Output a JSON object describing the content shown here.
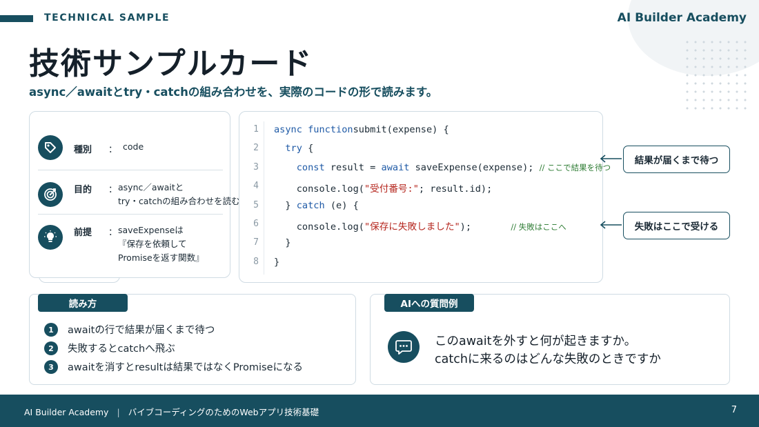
{
  "header": {
    "label": "TECHNICAL SAMPLE",
    "brand": "AI Builder Academy",
    "title": "技術サンプルカード",
    "subtitle": "async／awaitとtry・catchの組み合わせを、実際のコードの形で読みます。"
  },
  "info": {
    "rows": [
      {
        "label": "種別",
        "value_lines": [
          "code"
        ],
        "icon": "tag-icon"
      },
      {
        "label": "目的",
        "value_lines": [
          "async／awaitと",
          "try・catchの組み合わせを読む"
        ],
        "icon": "target-icon"
      },
      {
        "label": "前提",
        "value_lines": [
          "saveExpenseは",
          "『保存を依頼して",
          "Promiseを返す関数』"
        ],
        "icon": "lightbulb-icon"
      }
    ],
    "colon": "："
  },
  "code": {
    "lines": [
      {
        "n": "1",
        "parts": [
          [
            "kw",
            "async function"
          ],
          [
            "",
            "submit(expense) {"
          ]
        ]
      },
      {
        "n": "2",
        "parts": [
          [
            "",
            "  "
          ],
          [
            "kw",
            "try"
          ],
          [
            "",
            " {"
          ]
        ]
      },
      {
        "n": "3",
        "parts": [
          [
            "",
            "    "
          ],
          [
            "kw",
            "const"
          ],
          [
            "",
            " result = "
          ],
          [
            "kw",
            "await"
          ],
          [
            "",
            " saveExpense(expense); "
          ],
          [
            "cmt",
            "// ここで結果を待つ"
          ]
        ]
      },
      {
        "n": "4",
        "parts": [
          [
            "",
            "    console.log("
          ],
          [
            "str",
            "\"受付番号:\""
          ],
          [
            "",
            "; result.id);"
          ]
        ]
      },
      {
        "n": "5",
        "parts": [
          [
            "",
            "  } "
          ],
          [
            "kw",
            "catch"
          ],
          [
            "",
            " (e) {"
          ]
        ]
      },
      {
        "n": "6",
        "parts": [
          [
            "",
            "    console.log("
          ],
          [
            "str",
            "\"保存に失敗しました\""
          ],
          [
            "",
            ");       "
          ],
          [
            "cmt",
            "// 失敗はここへ"
          ]
        ]
      },
      {
        "n": "7",
        "parts": [
          [
            "",
            "  }"
          ]
        ]
      },
      {
        "n": "8",
        "parts": [
          [
            "",
            "}"
          ]
        ]
      }
    ]
  },
  "callouts": {
    "wait": "結果が届くまで待つ",
    "catch": "失敗はここで受ける"
  },
  "reading": {
    "title": "読み方",
    "steps": [
      {
        "n": "1",
        "text": "awaitの行で結果が届くまで待つ"
      },
      {
        "n": "2",
        "text": "失敗するとcatchへ飛ぶ"
      },
      {
        "n": "3",
        "text": "awaitを消すとresultは結果ではなくPromiseになる"
      }
    ]
  },
  "questions": {
    "title": "AIへの質問例",
    "lines": [
      "このawaitを外すと何が起きますか。",
      "catchに来るのはどんな失敗のときですか"
    ]
  },
  "footer": {
    "brand": "AI Builder Academy",
    "separator": "|",
    "course": "バイブコーディングのためのWebアプリ技術基礎",
    "page": "7"
  },
  "colors": {
    "accent": "#174e5f",
    "keyword": "#1f5aa6",
    "string": "#b5261e",
    "comment": "#2f7d35"
  }
}
